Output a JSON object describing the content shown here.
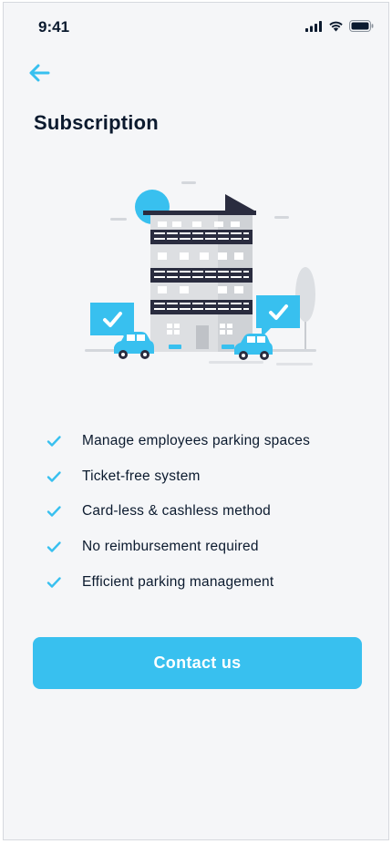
{
  "status_bar": {
    "time": "9:41",
    "icons": [
      "signal-icon",
      "wifi-icon",
      "battery-icon"
    ]
  },
  "header": {
    "back_icon": "arrow-left-icon",
    "title": "Subscription"
  },
  "illustration": {
    "name": "office-building-parking-illustration"
  },
  "features": [
    {
      "label": "Manage employees parking spaces",
      "icon": "check-icon"
    },
    {
      "label": "Ticket-free system",
      "icon": "check-icon"
    },
    {
      "label": "Card-less & cashless method",
      "icon": "check-icon"
    },
    {
      "label": "No reimbursement required",
      "icon": "check-icon"
    },
    {
      "label": "Efficient parking management",
      "icon": "check-icon"
    }
  ],
  "cta": {
    "label": "Contact us"
  },
  "colors": {
    "accent": "#38c0ef",
    "text": "#0b1a2e",
    "background": "#f5f6f8"
  }
}
